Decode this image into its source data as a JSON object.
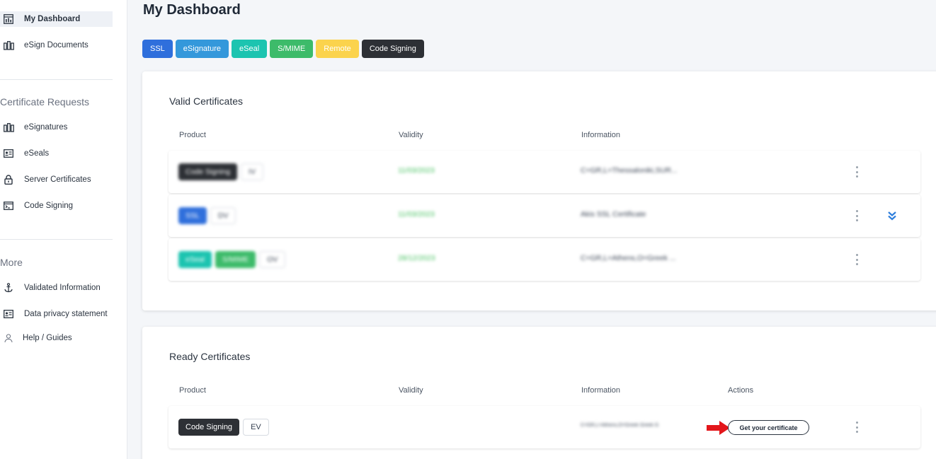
{
  "sidebar": {
    "top_items": [
      {
        "label": "My Dashboard",
        "icon": "dashboard-icon",
        "active": true
      },
      {
        "label": "eSign Documents",
        "icon": "documents-icon"
      }
    ],
    "sections": [
      {
        "title": "Certificate Requests",
        "items": [
          {
            "label": "eSignatures",
            "icon": "signature-icon"
          },
          {
            "label": "eSeals",
            "icon": "seal-icon"
          },
          {
            "label": "Server Certificates",
            "icon": "lock-icon"
          },
          {
            "label": "Code Signing",
            "icon": "terminal-icon"
          }
        ]
      },
      {
        "title": "More",
        "items": [
          {
            "label": "Validated Information",
            "icon": "anchor-icon"
          },
          {
            "label": "Data privacy statement",
            "icon": "id-card-icon"
          },
          {
            "label": "Help / Guides",
            "icon": "help-user-icon"
          }
        ]
      }
    ]
  },
  "page": {
    "title": "My Dashboard"
  },
  "filters": [
    {
      "label": "SSL",
      "color": "#2f6fdc"
    },
    {
      "label": "eSignature",
      "color": "#3498db"
    },
    {
      "label": "eSeal",
      "color": "#1cc4b0"
    },
    {
      "label": "S/MIME",
      "color": "#3dbb6a"
    },
    {
      "label": "Remote",
      "color": "#fbd34d"
    },
    {
      "label": "Code Signing",
      "color": "#2d3035"
    }
  ],
  "valid_certificates": {
    "title": "Valid Certificates",
    "columns": {
      "product": "Product",
      "validity": "Validity",
      "information": "Information"
    },
    "rows": [
      {
        "badges": [
          {
            "label": "Code Signing",
            "color": "#2d3035"
          }
        ],
        "type": "IV",
        "validity": "11/03/2023",
        "information": "C=GR,L=Thessaloniki,SUR..."
      },
      {
        "badges": [
          {
            "label": "SSL",
            "color": "#2f6fdc"
          }
        ],
        "type": "DV",
        "validity": "11/03/2023",
        "information": "Akis SSL Certificate"
      },
      {
        "badges": [
          {
            "label": "eSeal",
            "color": "#1cc4b0"
          },
          {
            "label": "S/MIME",
            "color": "#3dbb6a"
          }
        ],
        "type": "OV",
        "validity": "28/12/2023",
        "information": "C=GR,L=Athens,O=Greek ..."
      }
    ]
  },
  "ready_certificates": {
    "title": "Ready Certificates",
    "columns": {
      "product": "Product",
      "validity": "Validity",
      "information": "Information",
      "actions": "Actions"
    },
    "rows": [
      {
        "badges": [
          {
            "label": "Code Signing",
            "color": "#2d3035"
          }
        ],
        "type": "EV",
        "validity": "",
        "information": "C=GR,L=Athens,O=Greek Greek G",
        "action_label": "Get your certificate"
      }
    ]
  },
  "colors": {
    "arrow": "#e3161b",
    "validity_green": "#3fbf5a",
    "expand_blue": "#2f7fdc"
  }
}
